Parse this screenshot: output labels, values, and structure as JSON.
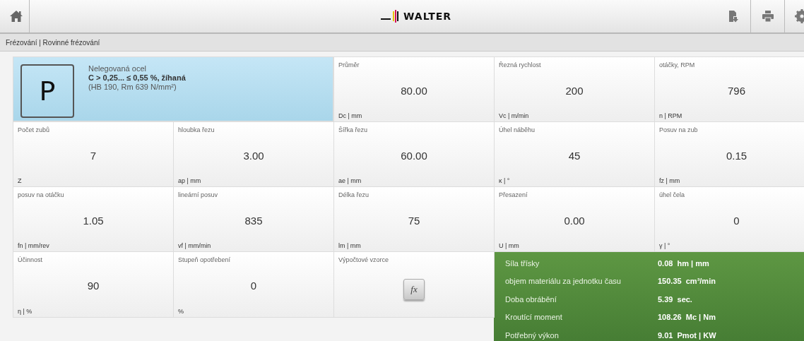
{
  "header": {
    "logo": "WALTER"
  },
  "breadcrumb": "Frézování | Rovinné frézování",
  "material": {
    "group": "P",
    "name": "Nelegovaná ocel",
    "grade": "C > 0,25... ≤ 0,55 %, žíhaná",
    "hardness": "(HB 190, Rm 639 N/mm²)"
  },
  "cells": [
    {
      "kind": "value",
      "label": "Průměr",
      "value": "80.00",
      "unit": "Dc | mm"
    },
    {
      "kind": "value",
      "label": "Řezná rychlost",
      "value": "200",
      "unit": "Vc | m/min"
    },
    {
      "kind": "value",
      "label": "otáčky, RPM",
      "value": "796",
      "unit": "n | RPM"
    },
    {
      "kind": "value",
      "label": "Počet zubů",
      "value": "7",
      "unit": "Z"
    },
    {
      "kind": "value",
      "label": "hloubka řezu",
      "value": "3.00",
      "unit": "ap | mm"
    },
    {
      "kind": "value",
      "label": "Šířka řezu",
      "value": "60.00",
      "unit": "ae | mm"
    },
    {
      "kind": "value",
      "label": "Úhel náběhu",
      "value": "45",
      "unit": "κ | °"
    },
    {
      "kind": "value",
      "label": "Posuv na zub",
      "value": "0.15",
      "unit": "fz | mm"
    },
    {
      "kind": "value",
      "label": "posuv na otáčku",
      "value": "1.05",
      "unit": "fn | mm/rev"
    },
    {
      "kind": "value",
      "label": "lineární posuv",
      "value": "835",
      "unit": "vf | mm/min"
    },
    {
      "kind": "value",
      "label": "Délka řezu",
      "value": "75",
      "unit": "lm | mm"
    },
    {
      "kind": "value",
      "label": "Přesazení",
      "value": "0.00",
      "unit": "U | mm"
    },
    {
      "kind": "value",
      "label": "úhel čela",
      "value": "0",
      "unit": "γ | °"
    },
    {
      "kind": "value",
      "label": "Účinnost",
      "value": "90",
      "unit": "η | %"
    },
    {
      "kind": "value",
      "label": "Stupeň opotřebení",
      "value": "0",
      "unit": "%"
    },
    {
      "kind": "formula",
      "label": "Výpočtové vzorce",
      "button": "fx"
    }
  ],
  "results": [
    {
      "label": "Síla třísky",
      "value": "0.08  hm | mm"
    },
    {
      "label": "objem materiálu za jednotku času",
      "value": "150.35  cm³/min"
    },
    {
      "label": "Doba obrábění",
      "value": "5.39  sec."
    },
    {
      "label": "Kroutící moment",
      "value": "108.26  Mc | Nm"
    },
    {
      "label": "Potřebný výkon",
      "value": "9.01  Pmot | KW"
    }
  ]
}
